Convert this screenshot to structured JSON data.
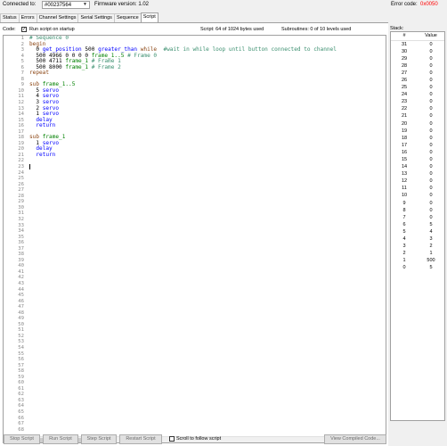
{
  "topbar": {
    "connected_label": "Connected to:",
    "device": "#00237564",
    "firmware": "Firmware version: 1.02",
    "error_label": "Error code:",
    "error_code": "0x0050"
  },
  "tabs": [
    "Status",
    "Errors",
    "Channel Settings",
    "Serial Settings",
    "Sequence",
    "Script"
  ],
  "active_tab": "Script",
  "options": {
    "code_label": "Code:",
    "run_on_startup": "Run script on startup",
    "script_usage": "Script: 64 of 1024 bytes used",
    "subroutines": "Subroutines: 0 of 10 levels used"
  },
  "line_numbers": [
    "1",
    "2",
    "3",
    "4",
    "5",
    "6",
    "7",
    "8",
    "9",
    "10",
    "11",
    "12",
    "13",
    "14",
    "15",
    "16",
    "17",
    "18",
    "19",
    "20",
    "21",
    "22",
    "23",
    "24",
    "25",
    "26",
    "27",
    "28",
    "29",
    "30",
    "31",
    "32",
    "33",
    "34",
    "35",
    "36",
    "37",
    "38",
    "39",
    "40",
    "41",
    "42",
    "43",
    "44",
    "45",
    "46",
    "47",
    "48",
    "49",
    "50",
    "51",
    "52",
    "53",
    "54",
    "55",
    "56",
    "57",
    "58",
    "59",
    "60",
    "61",
    "62",
    "63",
    "64",
    "65",
    "66",
    "67",
    "68"
  ],
  "code_lines": [
    [
      [
        "c-comment",
        "# Sequence 0"
      ]
    ],
    [
      [
        "c-kw",
        "begin"
      ]
    ],
    [
      [
        "c-num",
        "  0 "
      ],
      [
        "c-cmd",
        "get_position"
      ],
      [
        "c-num",
        " 500 "
      ],
      [
        "c-cmd",
        "greater_than"
      ],
      [
        "c-kw",
        " while"
      ],
      [
        "c-comment",
        "  #wait in while loop until button connected to channel"
      ]
    ],
    [
      [
        "c-num",
        "  500 4966 0 0 0 0 "
      ],
      [
        "c-label",
        "frame_1..5"
      ],
      [
        "c-comment",
        " # Frame 0"
      ]
    ],
    [
      [
        "c-num",
        "  500 4711 "
      ],
      [
        "c-label",
        "frame_1"
      ],
      [
        "c-comment",
        " # Frame 1"
      ]
    ],
    [
      [
        "c-num",
        "  500 8000 "
      ],
      [
        "c-label",
        "frame_1"
      ],
      [
        "c-comment",
        " # Frame 2"
      ]
    ],
    [
      [
        "c-kw",
        "repeat"
      ]
    ],
    [],
    [
      [
        "c-kw",
        "sub "
      ],
      [
        "c-label",
        "frame_1..5"
      ]
    ],
    [
      [
        "c-num",
        "  5 "
      ],
      [
        "c-cmd",
        "servo"
      ]
    ],
    [
      [
        "c-num",
        "  4 "
      ],
      [
        "c-cmd",
        "servo"
      ]
    ],
    [
      [
        "c-num",
        "  3 "
      ],
      [
        "c-cmd",
        "servo"
      ]
    ],
    [
      [
        "c-num",
        "  2 "
      ],
      [
        "c-cmd",
        "servo"
      ]
    ],
    [
      [
        "c-num",
        "  1 "
      ],
      [
        "c-cmd",
        "servo"
      ]
    ],
    [
      [
        "c-cmd",
        "  delay"
      ]
    ],
    [
      [
        "c-cmd",
        "  return"
      ]
    ],
    [],
    [
      [
        "c-kw",
        "sub "
      ],
      [
        "c-label",
        "frame_1"
      ]
    ],
    [
      [
        "c-num",
        "  1 "
      ],
      [
        "c-cmd",
        "servo"
      ]
    ],
    [
      [
        "c-cmd",
        "  delay"
      ]
    ],
    [
      [
        "c-cmd",
        "  return"
      ]
    ],
    [],
    [
      [
        "caret",
        ""
      ]
    ]
  ],
  "stack": {
    "title": "Stack:",
    "col_index": "#",
    "col_value": "Value",
    "rows": [
      [
        "31",
        "0"
      ],
      [
        "30",
        "0"
      ],
      [
        "29",
        "0"
      ],
      [
        "28",
        "0"
      ],
      [
        "27",
        "0"
      ],
      [
        "26",
        "0"
      ],
      [
        "25",
        "0"
      ],
      [
        "24",
        "0"
      ],
      [
        "23",
        "0"
      ],
      [
        "22",
        "0"
      ],
      [
        "21",
        "0"
      ],
      [
        "20",
        "0"
      ],
      [
        "19",
        "0"
      ],
      [
        "18",
        "0"
      ],
      [
        "17",
        "0"
      ],
      [
        "16",
        "0"
      ],
      [
        "15",
        "0"
      ],
      [
        "14",
        "0"
      ],
      [
        "13",
        "0"
      ],
      [
        "12",
        "0"
      ],
      [
        "11",
        "0"
      ],
      [
        "10",
        "0"
      ],
      [
        "9",
        "0"
      ],
      [
        "8",
        "0"
      ],
      [
        "7",
        "0"
      ],
      [
        "6",
        "5"
      ],
      [
        "5",
        "4"
      ],
      [
        "4",
        "3"
      ],
      [
        "3",
        "2"
      ],
      [
        "2",
        "1"
      ],
      [
        "1",
        "500"
      ],
      [
        "0",
        "5"
      ]
    ]
  },
  "buttons": {
    "stop": "Stop Script",
    "run": "Run Script",
    "step": "Step Script",
    "restart": "Restart Script",
    "scroll_follow": "Scroll to follow script",
    "view_compiled": "View Compiled Code..."
  },
  "colors": {
    "error_code": "#ff0000",
    "comment": "#3b8f6f",
    "keyword": "#8b4513",
    "label": "#008000",
    "command": "#0000ff"
  }
}
